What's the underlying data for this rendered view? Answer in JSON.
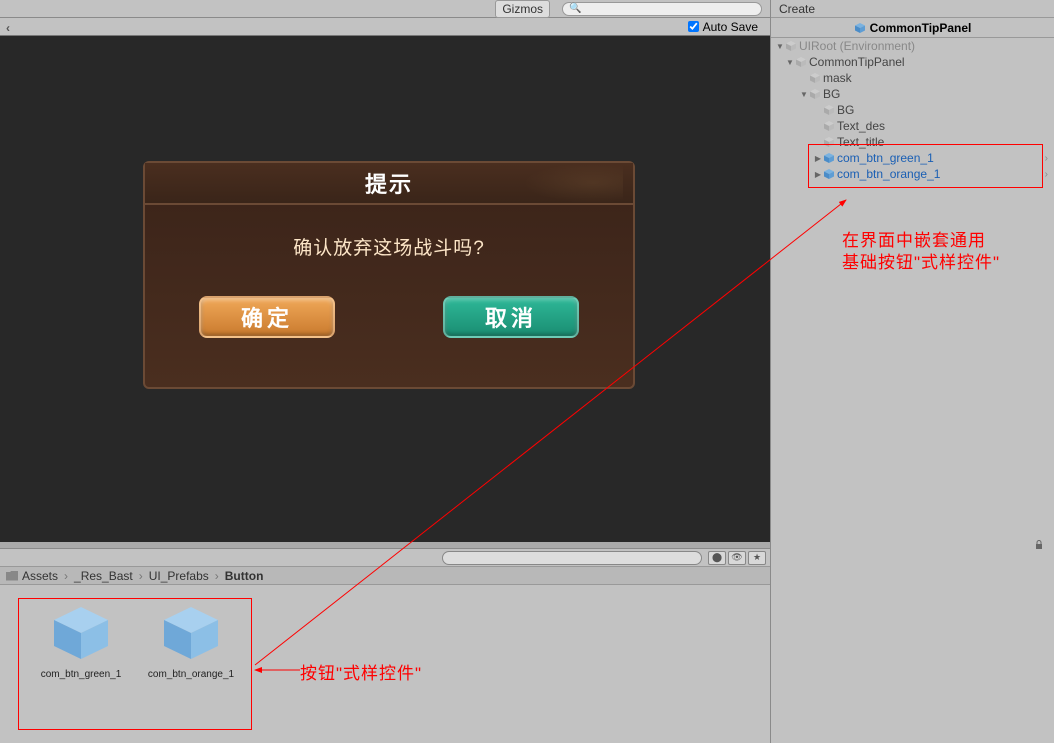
{
  "toolbar": {
    "gizmos": "Gizmos",
    "autosave": "Auto Save"
  },
  "dialog": {
    "title": "提示",
    "description": "确认放弃这场战斗吗?",
    "btn_confirm": "确定",
    "btn_cancel": "取消"
  },
  "breadcrumb": {
    "p1": "Assets",
    "p2": "_Res_Bast",
    "p3": "UI_Prefabs",
    "p4": "Button"
  },
  "assets": {
    "item1": "com_btn_green_1",
    "item2": "com_btn_orange_1"
  },
  "right": {
    "create": "Create",
    "header": "CommonTipPanel"
  },
  "hierarchy": {
    "root": "UIRoot (Environment)",
    "panel": "CommonTipPanel",
    "mask": "mask",
    "bg": "BG",
    "bg2": "BG",
    "text_des": "Text_des",
    "text_title": "Text_title",
    "btn_green": "com_btn_green_1",
    "btn_orange": "com_btn_orange_1"
  },
  "annot": {
    "right": "在界面中嵌套通用\n基础按钮\"式样控件\"",
    "bottom": "按钮\"式样控件\""
  }
}
